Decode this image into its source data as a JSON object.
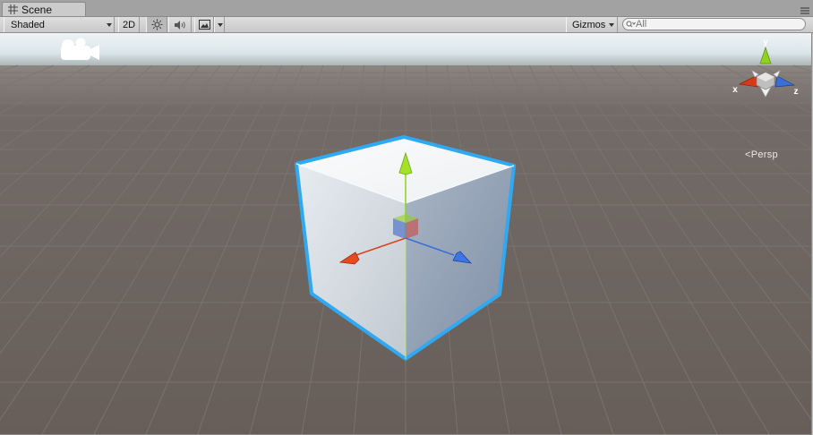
{
  "tab": {
    "label": "Scene",
    "icon": "grid-icon"
  },
  "toolbar": {
    "shading_mode": "Shaded",
    "mode_2d": "2D",
    "gizmos_label": "Gizmos",
    "search_placeholder": "All"
  },
  "gizmo": {
    "axis_x": "x",
    "axis_y": "y",
    "axis_z": "z",
    "projection": "Persp"
  },
  "colors": {
    "x_axis": "#d9431e",
    "y_axis": "#8fd11e",
    "z_axis": "#3a6fd8",
    "selection_outline": "#2ea9f2",
    "ground": "#6a615c",
    "sky": "#e8eff2"
  }
}
